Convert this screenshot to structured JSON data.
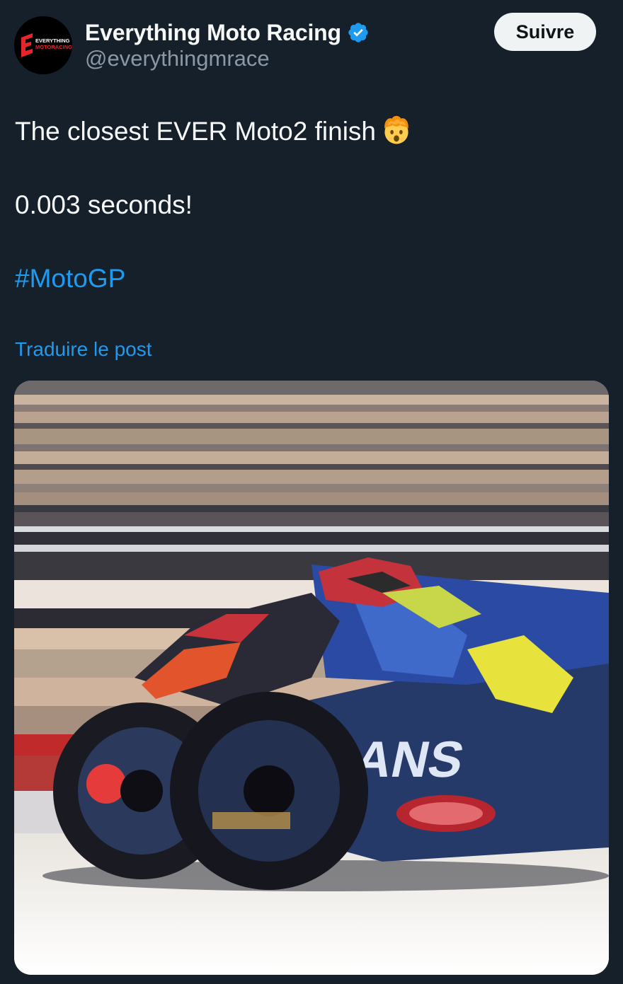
{
  "author": {
    "display_name": "Everything Moto Racing",
    "handle": "@everythingmrace",
    "verified": true,
    "avatar_icon": "everything-moto-racing-logo",
    "logo_text_line1": "EVERYTHING",
    "logo_text_line2": "MOTORACING"
  },
  "follow_button": {
    "label": "Suivre"
  },
  "tweet": {
    "line1": "The closest EVER Moto2 finish",
    "line1_emoji": "exploding-head-emoji",
    "line2": "0.003 seconds!",
    "hashtag": "#MotoGP"
  },
  "translate_link": "Traduire le post",
  "media": {
    "type": "photo",
    "description_icon": "photo-finish-image"
  },
  "colors": {
    "background": "#15202b",
    "text": "#f7f9f9",
    "secondary_text": "#8b98a5",
    "accent": "#1d9bf0",
    "button_bg": "#eff3f4",
    "logo_red": "#e8242b"
  }
}
